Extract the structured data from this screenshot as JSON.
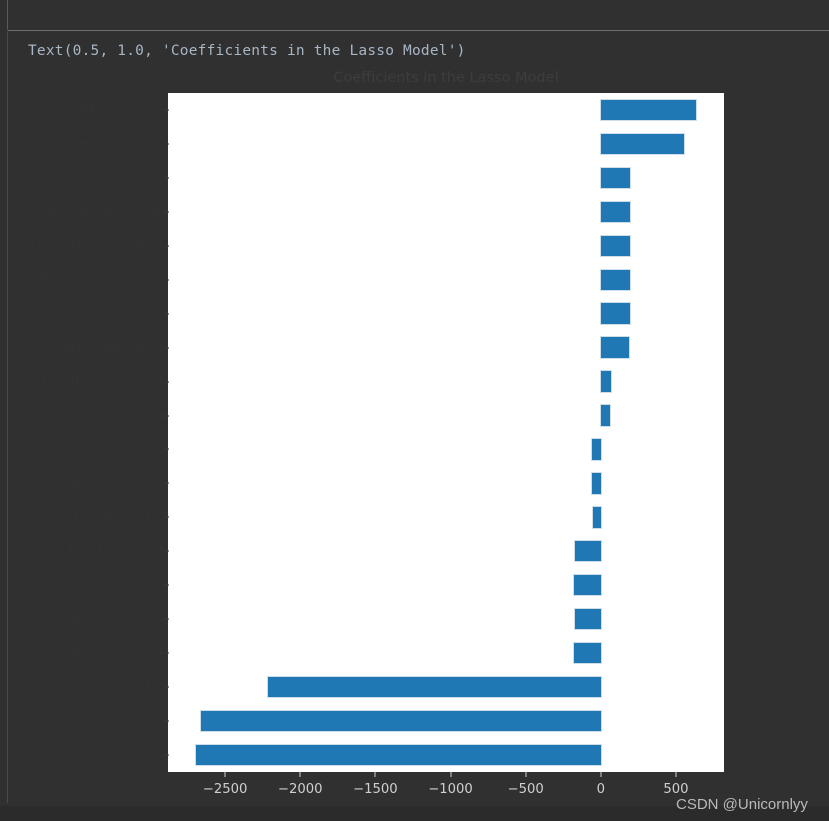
{
  "notebook": {
    "output_repr": "Text(0.5, 1.0, 'Coefficients in the Lasso Model')",
    "watermark": "CSDN @Unicornlyy"
  },
  "chart_data": {
    "type": "bar",
    "orientation": "horizontal",
    "title": "Coefficients in the Lasso Model",
    "xlabel": "",
    "ylabel": "",
    "xlim": [
      -2880,
      820
    ],
    "xticks": [
      -2500,
      -2000,
      -1500,
      -1000,
      -500,
      0,
      500
    ],
    "xticklabels": [
      "−2500",
      "−2000",
      "−1500",
      "−1000",
      "−500",
      "0",
      "500"
    ],
    "grid": false,
    "legend": null,
    "bar_color": "#1f77b4",
    "bar_edge_color": "#cfdde8",
    "axes_facecolor": "#ffffff",
    "figure_facecolor": "#303030",
    "categories": [
      "RoofMatl_ClyTile",
      "MiscFeature_TenC",
      "BsmtFinType2_LwQ",
      "BsmtFinType2_Unf",
      "BsmtFinType2_ALQ",
      "BsmtFinType2_Rec",
      "BsmtFinType2_GLQ",
      "BsmtFinType2_BLQ",
      "BsmtExposure_Gd",
      "BsmtExposure_No",
      "BsmtQual_TA",
      "BsmtQual_Gd",
      "BsmtQual_Ex",
      "BsmtCond_Gd",
      "BsmtCond_Fa",
      "BsmtCond_TA",
      "BsmtCond_Po",
      "PoolQC_Ex",
      "PoolQC_Gd",
      "PoolQC_Fa"
    ],
    "values": [
      636,
      552,
      195,
      192,
      196,
      193,
      197,
      190,
      66,
      64,
      -58,
      -60,
      -52,
      -170,
      -175,
      -172,
      -180,
      -2215,
      -2660,
      -2695
    ]
  }
}
